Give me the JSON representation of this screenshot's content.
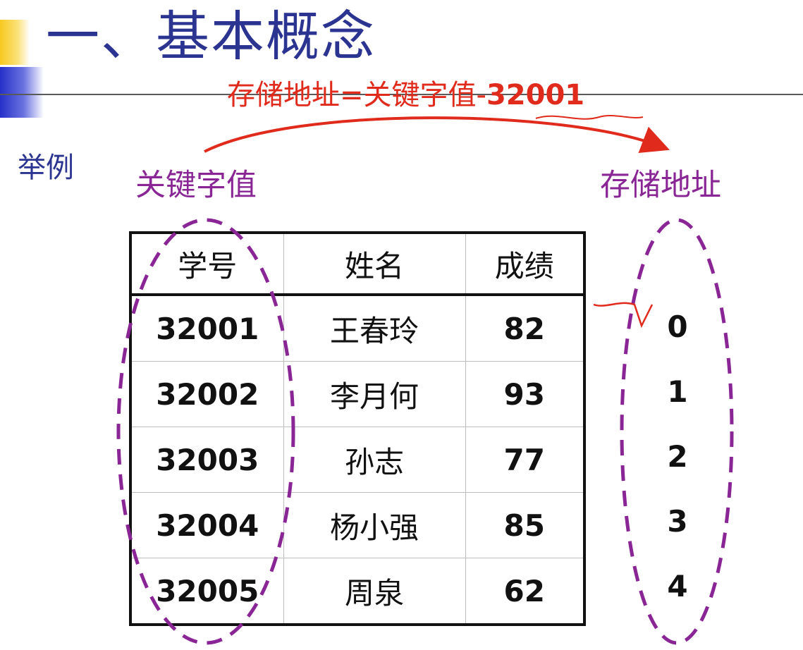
{
  "title": "一、基本概念",
  "formula": {
    "prefix": "存储地址=关键字值-",
    "offset": "32001"
  },
  "example_label": "举例",
  "key_label": "关键字值",
  "address_label": "存储地址",
  "table": {
    "headers": [
      "学号",
      "姓名",
      "成绩"
    ],
    "rows": [
      [
        "32001",
        "王春玲",
        "82"
      ],
      [
        "32002",
        "李月何",
        "93"
      ],
      [
        "32003",
        "孙志",
        "77"
      ],
      [
        "32004",
        "杨小强",
        "85"
      ],
      [
        "32005",
        "周泉",
        "62"
      ]
    ]
  },
  "addresses": [
    "0",
    "1",
    "2",
    "3",
    "4"
  ],
  "colors": {
    "title": "#2b3591",
    "formula": "#e02a1c",
    "labels": "#8a2596",
    "ellipse": "#8a2596",
    "annotation": "#e02a1c"
  }
}
